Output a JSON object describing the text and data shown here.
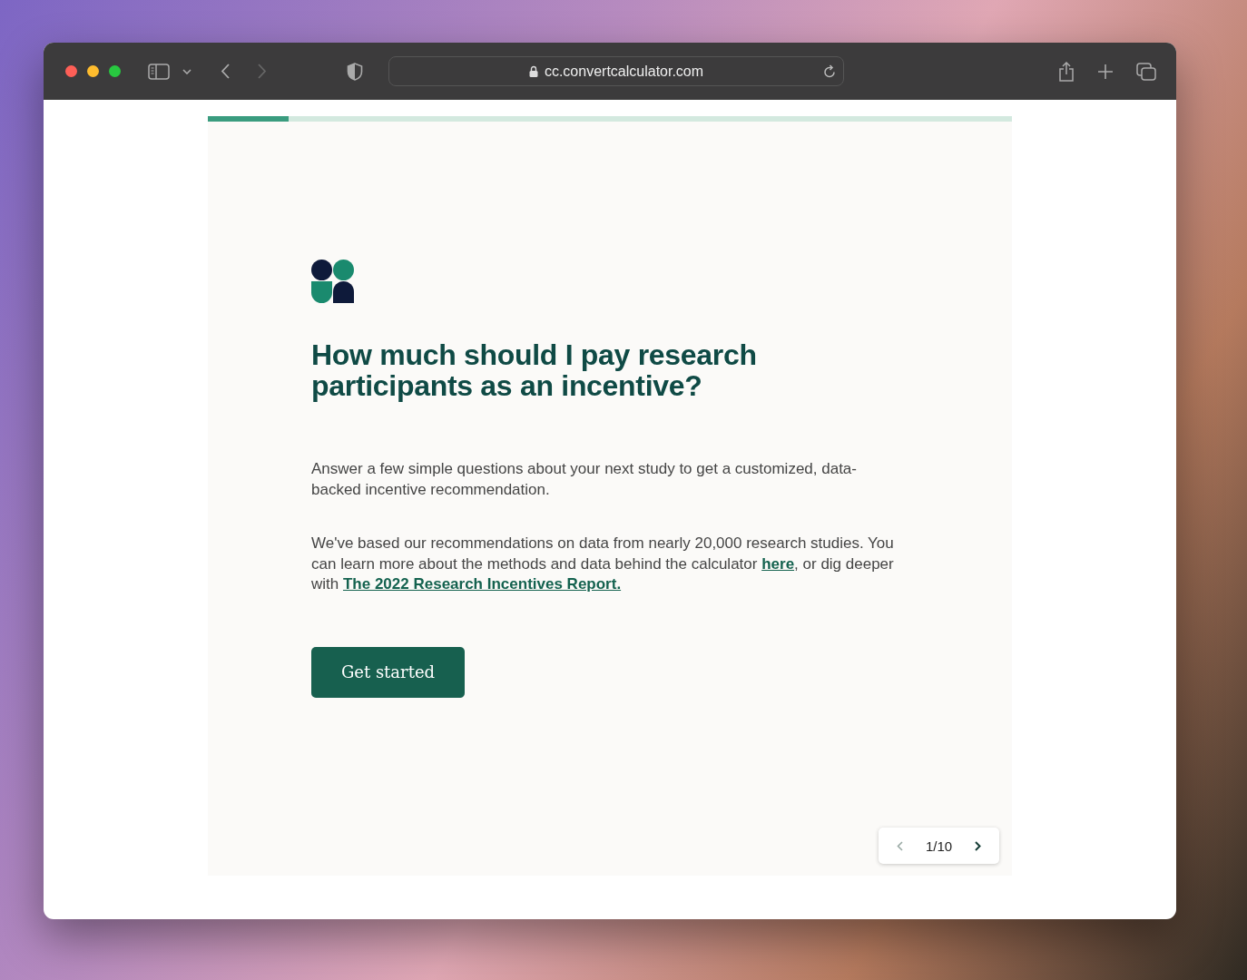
{
  "browser": {
    "url": "cc.convertcalculator.com",
    "back_disabled": false,
    "forward_disabled": true
  },
  "progress": {
    "level": 0.1
  },
  "heading": "How much should I pay research participants as an incentive?",
  "intro": "Answer a few simple questions about your next study to get a customized, data-backed incentive recommendation.",
  "details": {
    "text_before": "We've based our recommendations on data from nearly 20,000 research studies. You can learn more about the methods and data behind the calculator",
    "link_1": "here",
    "text_middle": ", or dig deeper with",
    "link_2": "The 2022 Research Incentives Report."
  },
  "button": "Get started",
  "pager": {
    "page": "1/10",
    "prev_disabled": true,
    "next_disabled": false
  }
}
